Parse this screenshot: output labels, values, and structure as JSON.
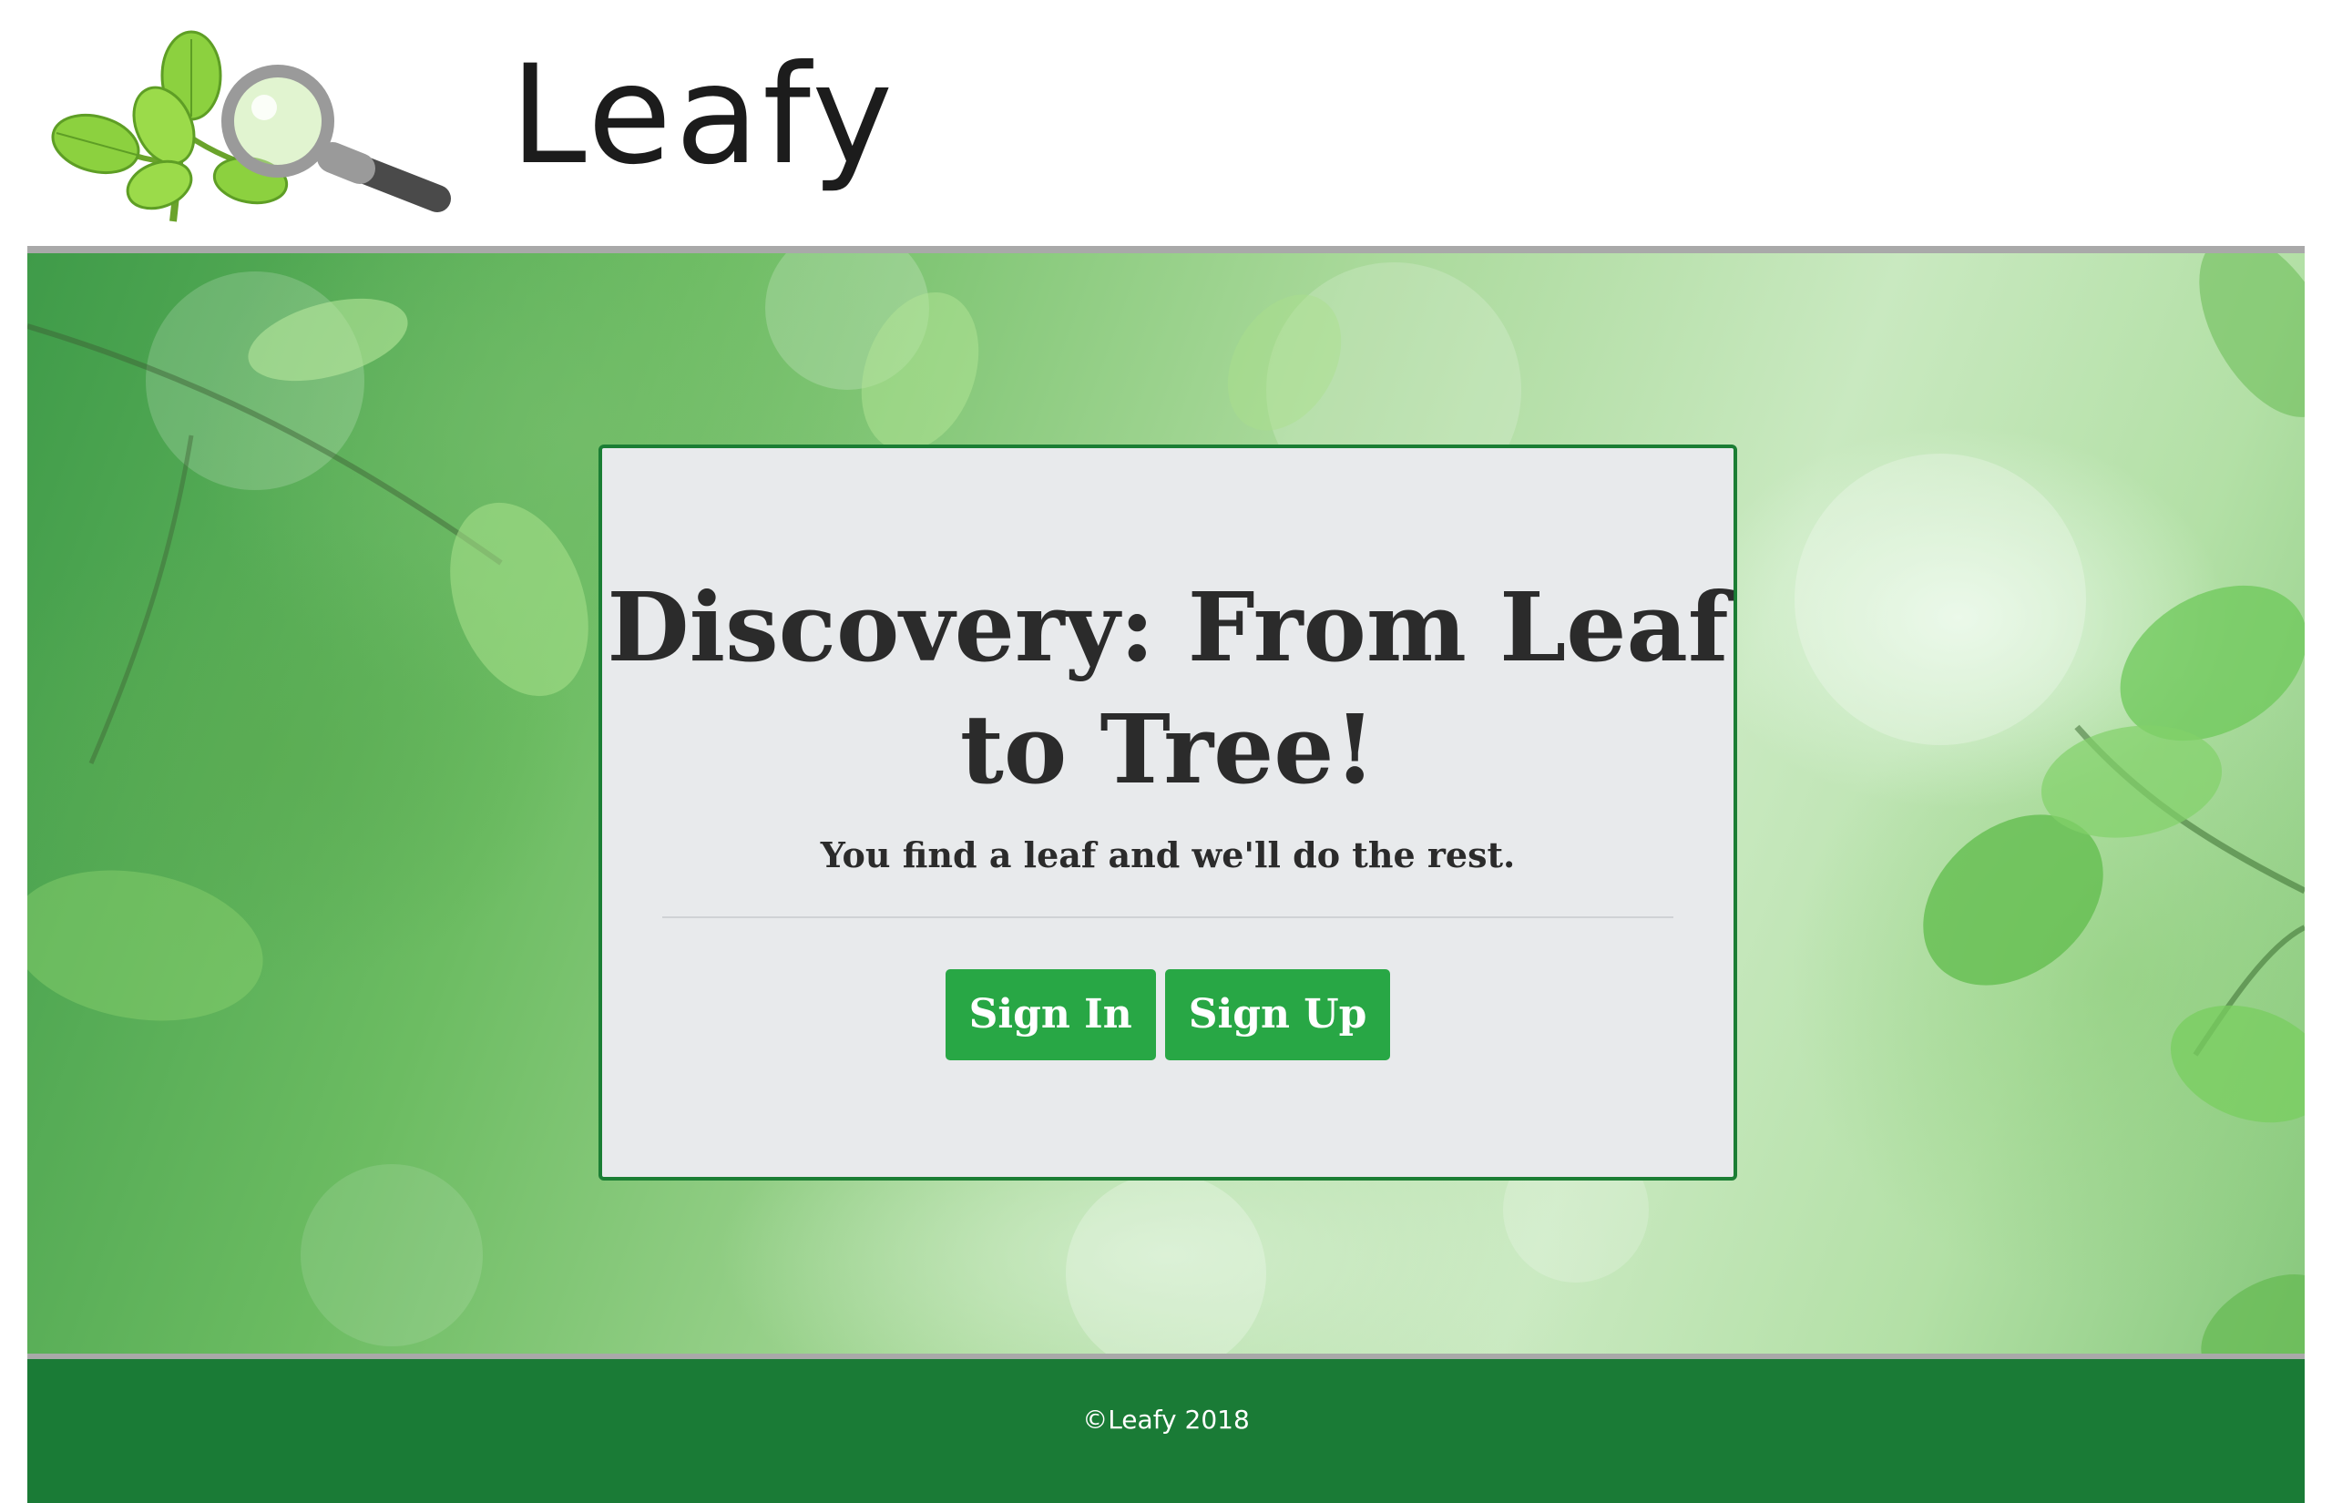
{
  "header": {
    "brand_name": "Leafy",
    "logo_icon": "leaf-magnifier-icon"
  },
  "hero": {
    "title": "Discovery: From Leaf to Tree!",
    "subtitle": "You find a leaf and we'll do the rest.",
    "sign_in_label": "Sign In",
    "sign_up_label": "Sign Up"
  },
  "footer": {
    "copyright": "©Leafy 2018"
  },
  "colors": {
    "brand_green": "#1a7b36",
    "button_green": "#28a745",
    "card_background": "#e8eaec",
    "card_border": "#1b7e34"
  }
}
